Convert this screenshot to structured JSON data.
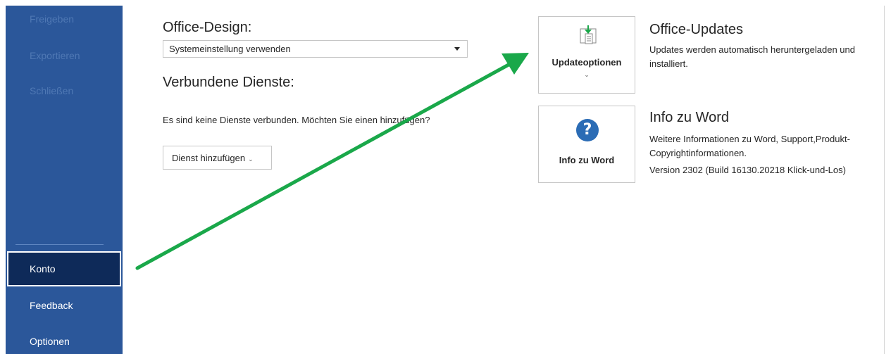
{
  "sidebar": {
    "items_top": [
      {
        "label": "Freigeben"
      },
      {
        "label": "Exportieren"
      },
      {
        "label": "Schließen"
      }
    ],
    "selected": {
      "label": "Konto"
    },
    "items_bottom": [
      {
        "label": "Feedback"
      },
      {
        "label": "Optionen"
      }
    ]
  },
  "main": {
    "design_title": "Office-Design:",
    "design_select_value": "Systemeinstellung verwenden",
    "services_title": "Verbundene Dienste:",
    "services_text": "Es sind keine Dienste verbunden. Möchten Sie einen hinzufügen?",
    "add_service_label": "Dienst hinzufügen"
  },
  "updates": {
    "tile_label": "Updateoptionen",
    "title": "Office-Updates",
    "line1": "Updates werden automatisch heruntergeladen und",
    "line2": "installiert."
  },
  "about": {
    "tile_label": "Info zu Word",
    "title": "Info zu Word",
    "line1": "Weitere Informationen zu Word, Support,Produkt-",
    "line2": "Copyrightinformationen.",
    "line3": "Version 2302 (Build 16130.20218 Klick-und-Los)"
  },
  "colors": {
    "sidebar": "#2b579a",
    "sidebar_selected": "#0e2a59",
    "arrow": "#1aa84a"
  }
}
